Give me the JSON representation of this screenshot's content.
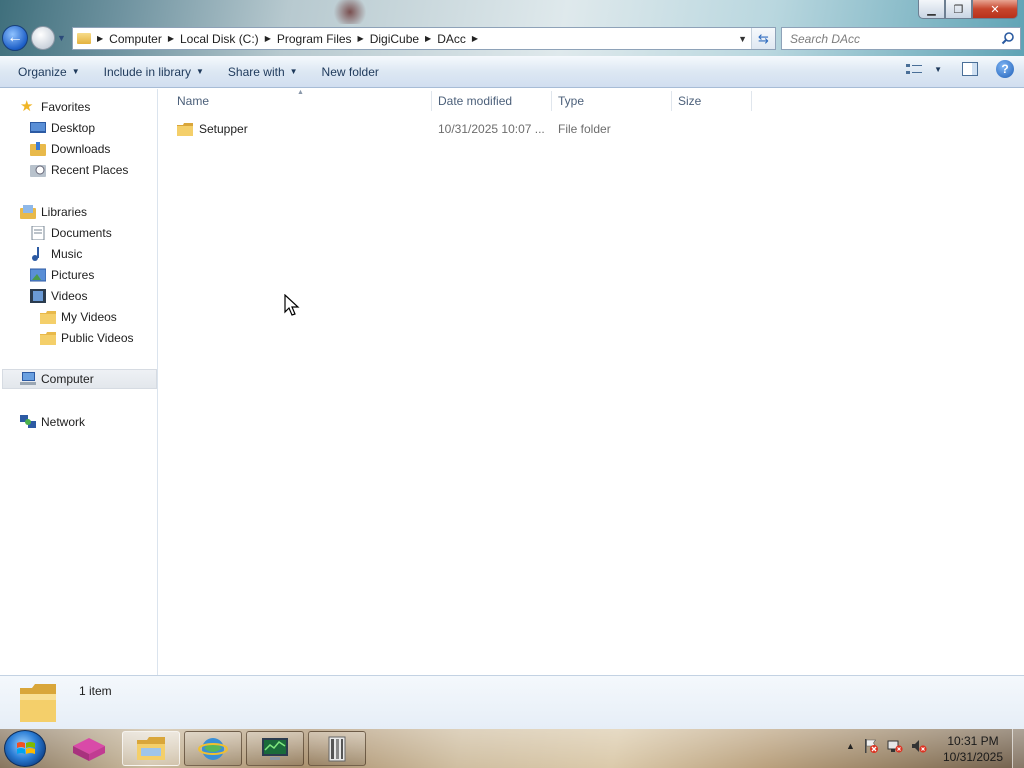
{
  "window": {
    "minimize": "▁",
    "maximize": "❐",
    "close": "✕"
  },
  "address": {
    "crumbs": [
      "Computer",
      "Local Disk (C:)",
      "Program Files",
      "DigiCube",
      "DAcc"
    ]
  },
  "search": {
    "placeholder": "Search DAcc"
  },
  "toolbar": {
    "organize": "Organize",
    "include": "Include in library",
    "share": "Share with",
    "new_folder": "New folder",
    "help": "?"
  },
  "nav": {
    "favorites": "Favorites",
    "desktop": "Desktop",
    "downloads": "Downloads",
    "recent": "Recent Places",
    "libraries": "Libraries",
    "documents": "Documents",
    "music": "Music",
    "pictures": "Pictures",
    "videos": "Videos",
    "my_videos": "My Videos",
    "public_videos": "Public Videos",
    "computer": "Computer",
    "network": "Network"
  },
  "columns": {
    "name": "Name",
    "date": "Date modified",
    "type": "Type",
    "size": "Size"
  },
  "files": [
    {
      "name": "Setupper",
      "date": "10/31/2025 10:07 ...",
      "type": "File folder",
      "size": ""
    }
  ],
  "details": {
    "count": "1 item"
  },
  "taskbar": {
    "time": "10:31 PM",
    "date": "10/31/2025"
  },
  "colors": {
    "accent": "#1e395b",
    "header_text": "#4c607a",
    "folder": "#e8b94a"
  }
}
